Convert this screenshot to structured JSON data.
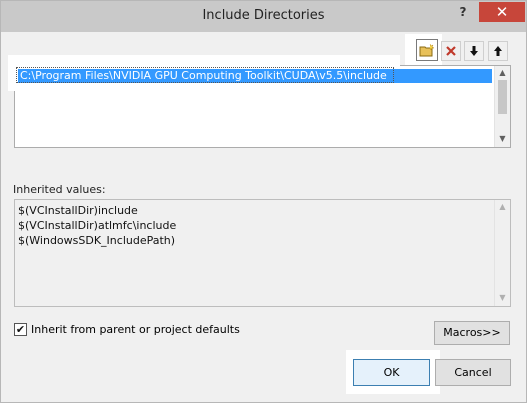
{
  "window": {
    "title": "Include Directories",
    "help_label": "?",
    "close_label": "✕"
  },
  "toolbar": {
    "new_line_icon": "new-folder-icon",
    "delete_icon": "delete-x-icon",
    "move_down_icon": "arrow-down-icon",
    "move_up_icon": "arrow-up-icon"
  },
  "directories": {
    "items": [
      {
        "label": "C:\\Program Files\\NVIDIA GPU Computing Toolkit\\CUDA\\v5.5\\include",
        "selected": true
      }
    ]
  },
  "inherited": {
    "label": "Inherited values:",
    "values": [
      "$(VCInstallDir)include",
      "$(VCInstallDir)atlmfc\\include",
      "$(WindowsSDK_IncludePath)"
    ]
  },
  "options": {
    "inherit_label": "Inherit from parent or project defaults",
    "inherit_checked": true,
    "check_glyph": "✔"
  },
  "buttons": {
    "macros": "Macros>>",
    "ok": "OK",
    "cancel": "Cancel"
  },
  "colors": {
    "selection": "#3399ff",
    "close": "#c7463a",
    "delete_icon": "#c0392b"
  }
}
